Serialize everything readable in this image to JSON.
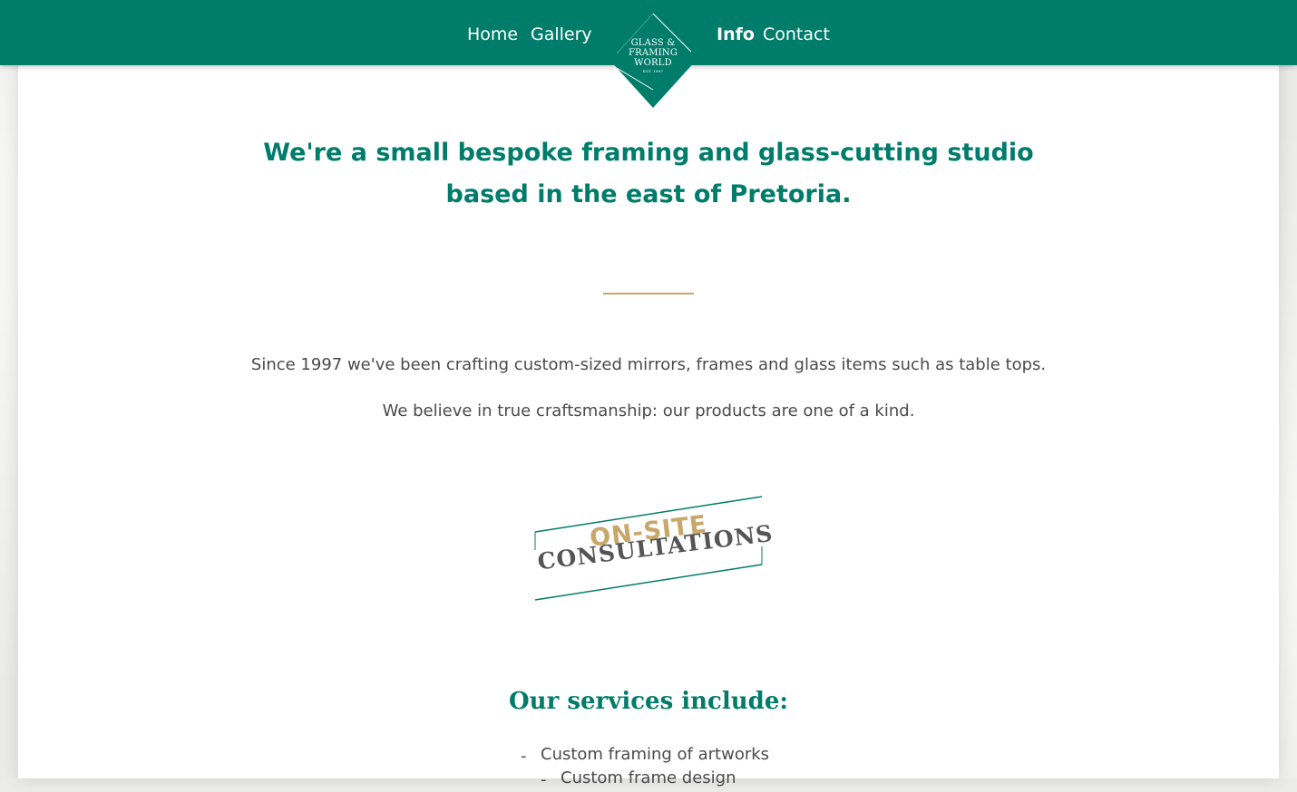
{
  "nav": {
    "left_links": [
      "Home",
      "Gallery"
    ],
    "right_links": [
      "Info",
      "Contact"
    ],
    "active": "Info"
  },
  "logo": {
    "line1": "GLASS &",
    "line2": "FRAMING",
    "line3": "WORLD",
    "est": "EST. 1997"
  },
  "hero": {
    "headline": "We're a small bespoke framing and glass-cutting studio based in the east of Pretoria."
  },
  "intro": {
    "line1": "Since 1997 we've been crafting custom-sized mirrors, frames and glass items such as table tops.",
    "line2": "We believe in true craftsmanship: our products are one of a kind."
  },
  "badge": {
    "top": "ON-SITE",
    "bottom": "CONSULTATIONS"
  },
  "services": {
    "title": "Our services include:",
    "items": [
      "Custom framing of artworks",
      "Custom frame design"
    ]
  },
  "colors": {
    "brand_green": "#007c6a",
    "accent_gold": "#c8a76a",
    "body_text": "#4a4a4a"
  }
}
